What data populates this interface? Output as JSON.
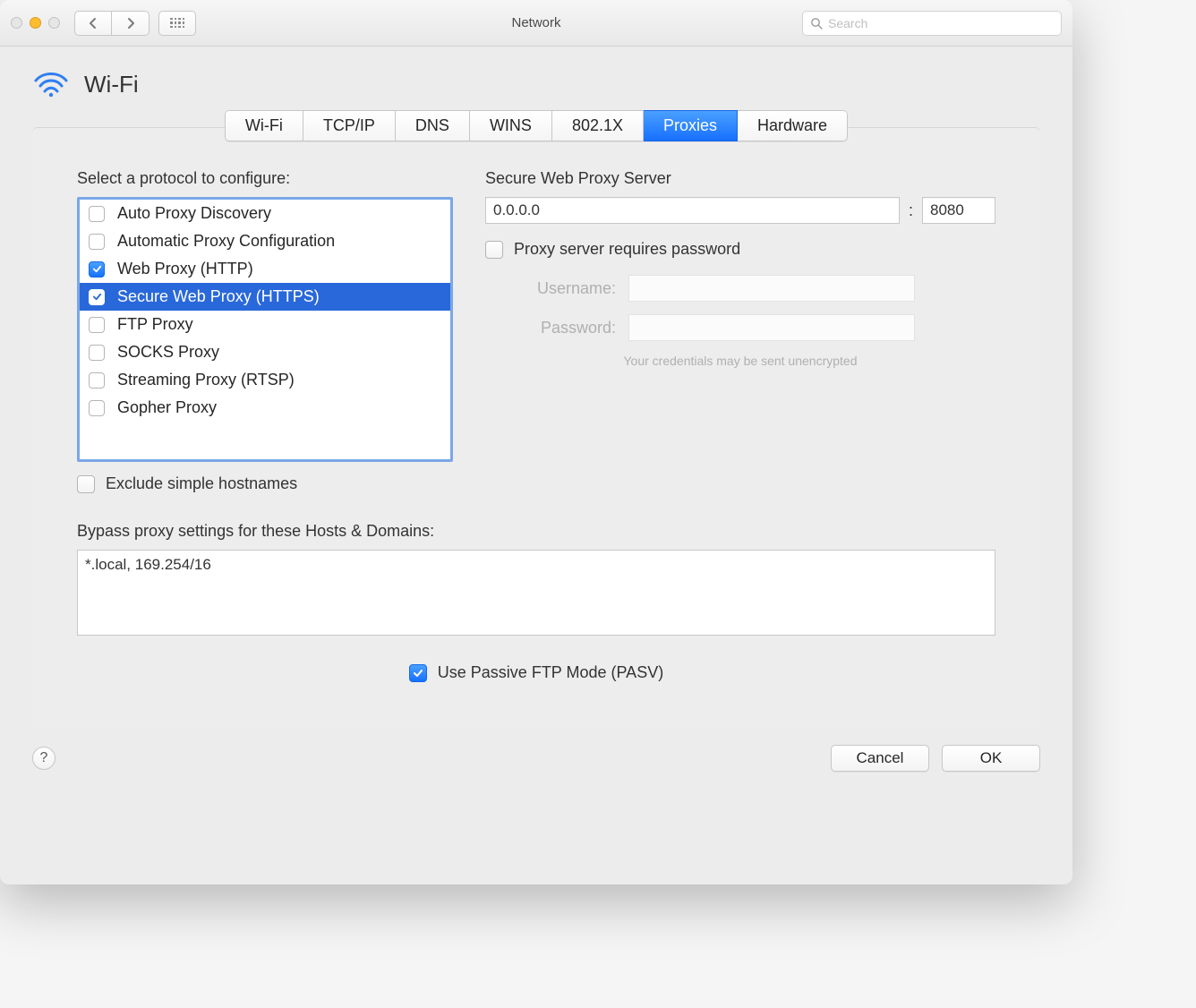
{
  "window": {
    "title": "Network"
  },
  "search": {
    "placeholder": "Search"
  },
  "header": {
    "title": "Wi-Fi"
  },
  "tabs": [
    "Wi-Fi",
    "TCP/IP",
    "DNS",
    "WINS",
    "802.1X",
    "Proxies",
    "Hardware"
  ],
  "activeTab": "Proxies",
  "left": {
    "label": "Select a protocol to configure:",
    "protocols": [
      {
        "label": "Auto Proxy Discovery",
        "checked": false,
        "selected": false
      },
      {
        "label": "Automatic Proxy Configuration",
        "checked": false,
        "selected": false
      },
      {
        "label": "Web Proxy (HTTP)",
        "checked": true,
        "selected": false
      },
      {
        "label": "Secure Web Proxy (HTTPS)",
        "checked": true,
        "selected": true
      },
      {
        "label": "FTP Proxy",
        "checked": false,
        "selected": false
      },
      {
        "label": "SOCKS Proxy",
        "checked": false,
        "selected": false
      },
      {
        "label": "Streaming Proxy (RTSP)",
        "checked": false,
        "selected": false
      },
      {
        "label": "Gopher Proxy",
        "checked": false,
        "selected": false
      }
    ],
    "excludeSimple": {
      "label": "Exclude simple hostnames",
      "checked": false
    }
  },
  "right": {
    "serverLabel": "Secure Web Proxy Server",
    "serverAddress": "0.0.0.0",
    "serverPort": "8080",
    "requiresPassword": {
      "label": "Proxy server requires password",
      "checked": false
    },
    "usernameLabel": "Username:",
    "usernameValue": "",
    "passwordLabel": "Password:",
    "passwordValue": "",
    "credentialsNote": "Your credentials may be sent unencrypted"
  },
  "bypass": {
    "label": "Bypass proxy settings for these Hosts & Domains:",
    "value": "*.local, 169.254/16"
  },
  "pasv": {
    "label": "Use Passive FTP Mode (PASV)",
    "checked": true
  },
  "footer": {
    "helpTooltip": "?",
    "cancel": "Cancel",
    "ok": "OK"
  }
}
